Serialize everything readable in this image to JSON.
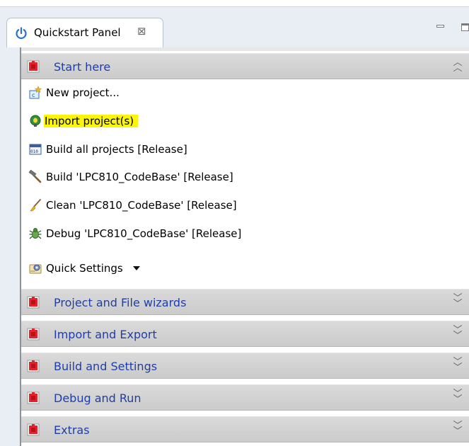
{
  "tab": {
    "title": "Quickstart Panel",
    "close_glyph": "⊠",
    "icon": "power-icon"
  },
  "sections": [
    {
      "label": "Start here",
      "state": "expanded",
      "icon": "red-puzzle-icon"
    },
    {
      "label": "Project and File wizards",
      "state": "collapsed",
      "icon": "red-puzzle-icon"
    },
    {
      "label": "Import and Export",
      "state": "collapsed",
      "icon": "red-puzzle-icon"
    },
    {
      "label": "Build and Settings",
      "state": "collapsed",
      "icon": "red-puzzle-icon"
    },
    {
      "label": "Debug and Run",
      "state": "collapsed",
      "icon": "red-puzzle-icon"
    },
    {
      "label": "Extras",
      "state": "collapsed",
      "icon": "red-puzzle-icon"
    }
  ],
  "start_items": [
    {
      "label": "New project...",
      "icon": "new-project-icon"
    },
    {
      "label": "Import project(s)",
      "icon": "import-bulb-icon",
      "highlighted": true
    },
    {
      "label": "Build all projects [Release]",
      "icon": "binary-build-icon"
    },
    {
      "label": "Build 'LPC810_CodeBase' [Release]",
      "icon": "hammer-icon"
    },
    {
      "label": "Clean 'LPC810_CodeBase' [Release]",
      "icon": "broom-icon"
    },
    {
      "label": "Debug 'LPC810_CodeBase' [Release]",
      "icon": "bug-icon"
    },
    {
      "label": "Quick Settings",
      "icon": "settings-icon",
      "dropdown": true
    }
  ],
  "colors": {
    "section_text": "#1f3ea8",
    "highlight": "#fbf50a",
    "header_bg": "#d2d2d2"
  }
}
